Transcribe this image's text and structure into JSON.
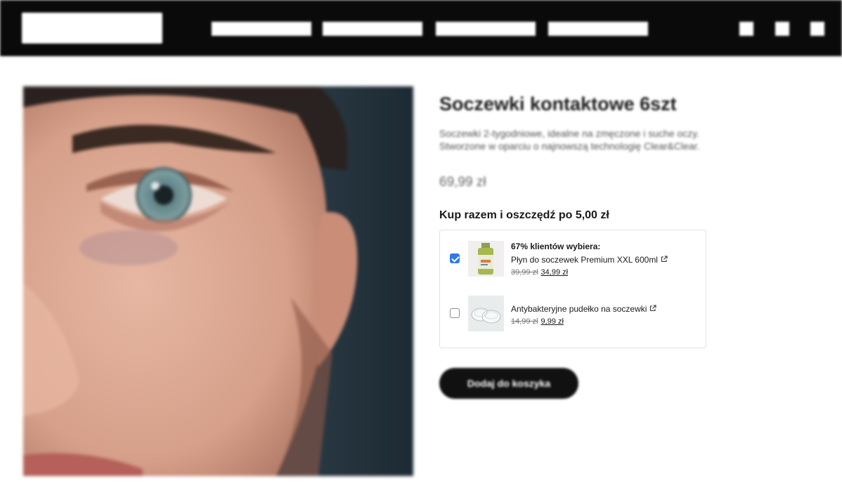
{
  "product": {
    "title": "Soczewki kontaktowe 6szt",
    "description_line1": "Soczewki 2-tygodniowe, idealne na zmęczone i suche oczy.",
    "description_line2": "Stworzone w oparciu o najnowszą technologię Clear&Clear.",
    "price": "69,99 zł",
    "add_to_cart_label": "Dodaj do koszyka"
  },
  "bundle": {
    "title": "Kup razem i oszczędź po 5,00 zł",
    "items": [
      {
        "badge": "67% klientów wybiera:",
        "name": "Płyn do soczewek Premium XXL 600ml",
        "old_price": "39,99 zł",
        "new_price": "34,99 zł",
        "checked": true
      },
      {
        "badge": "",
        "name": "Antybakteryjne pudełko na soczewki",
        "old_price": "14,99 zł",
        "new_price": "9,99 zł",
        "checked": false
      }
    ]
  },
  "colors": {
    "header_bg": "#0a0a0a",
    "checkbox_accent": "#2f7ae5",
    "button_bg": "#111111"
  },
  "icons": [
    "external-link-icon",
    "checkbox-checked-icon",
    "checkbox-unchecked-icon"
  ]
}
